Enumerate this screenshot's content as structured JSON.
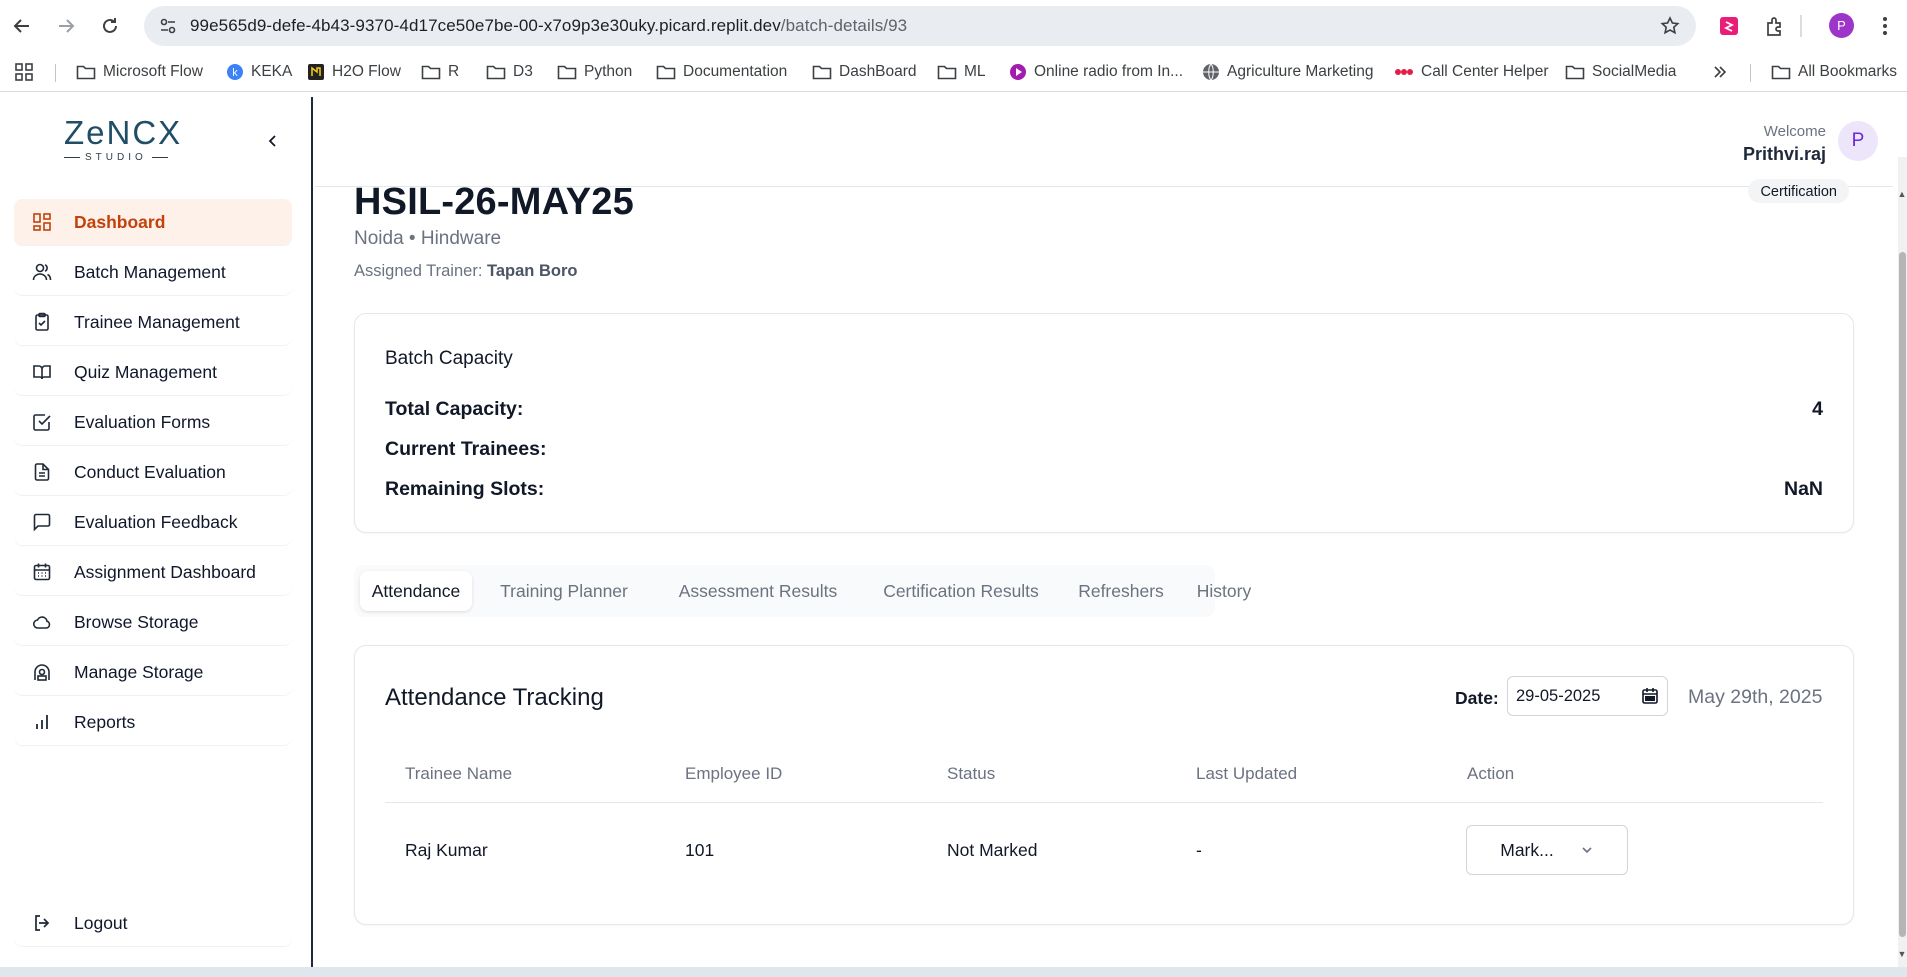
{
  "browser": {
    "url_host": "99e565d9-defe-4b43-9370-4d17ce50e7be-00-x7o9p3e30uky.picard.replit.dev",
    "url_path": "/batch-details/93",
    "profile_initial": "P",
    "bookmarks": [
      {
        "label": "Microsoft Flow",
        "icon": "folder-icon"
      },
      {
        "label": "KEKA",
        "icon": "keka-icon"
      },
      {
        "label": "H2O Flow",
        "icon": "h2o-icon"
      },
      {
        "label": "R",
        "icon": "folder-icon"
      },
      {
        "label": "D3",
        "icon": "folder-icon"
      },
      {
        "label": "Python",
        "icon": "folder-icon"
      },
      {
        "label": "Documentation",
        "icon": "folder-icon"
      },
      {
        "label": "DashBoard",
        "icon": "folder-icon"
      },
      {
        "label": "ML",
        "icon": "folder-icon"
      },
      {
        "label": "Online radio from In...",
        "icon": "radio-icon"
      },
      {
        "label": "Agriculture Marketing",
        "icon": "globe-icon"
      },
      {
        "label": "Call Center Helper",
        "icon": "dots-icon"
      },
      {
        "label": "SocialMedia",
        "icon": "folder-icon"
      }
    ],
    "all_bookmarks": "All Bookmarks"
  },
  "sidebar": {
    "logo_text": "ZeNCX",
    "logo_sub": "STUDIO",
    "items": [
      {
        "label": "Dashboard",
        "icon": "dashboard-icon",
        "active": true
      },
      {
        "label": "Batch Management",
        "icon": "users-icon"
      },
      {
        "label": "Trainee Management",
        "icon": "clipboard-check-icon"
      },
      {
        "label": "Quiz Management",
        "icon": "book-open-icon"
      },
      {
        "label": "Evaluation Forms",
        "icon": "check-square-icon"
      },
      {
        "label": "Conduct Evaluation",
        "icon": "file-text-icon"
      },
      {
        "label": "Evaluation Feedback",
        "icon": "message-square-icon"
      },
      {
        "label": "Assignment Dashboard",
        "icon": "calendar-icon"
      },
      {
        "label": "Browse Storage",
        "icon": "cloud-icon"
      },
      {
        "label": "Manage Storage",
        "icon": "storage-icon"
      },
      {
        "label": "Reports",
        "icon": "bar-chart-icon"
      }
    ],
    "logout": "Logout"
  },
  "header": {
    "welcome": "Welcome",
    "user_name": "Prithvi.raj",
    "avatar_initial": "P"
  },
  "batch": {
    "title": "HSIL-26-MAY25",
    "subtitle": "Noida • Hindware",
    "trainer_label": "Assigned Trainer:",
    "trainer_name": "Tapan Boro",
    "badge": "Certification"
  },
  "capacity": {
    "title": "Batch Capacity",
    "rows": [
      {
        "label": "Total Capacity:",
        "value": "4"
      },
      {
        "label": "Current Trainees:",
        "value": ""
      },
      {
        "label": "Remaining Slots:",
        "value": "NaN"
      }
    ]
  },
  "tabs": [
    "Attendance",
    "Training Planner",
    "Assessment Results",
    "Certification Results",
    "Refreshers",
    "History"
  ],
  "attendance": {
    "title": "Attendance Tracking",
    "date_label": "Date:",
    "date_value": "29-05-2025",
    "date_formatted": "May 29th, 2025",
    "columns": [
      "Trainee Name",
      "Employee ID",
      "Status",
      "Last Updated",
      "Action"
    ],
    "rows": [
      {
        "name": "Raj Kumar",
        "employee_id": "101",
        "status": "Not Marked",
        "last_updated": "-",
        "action": "Mark..."
      }
    ]
  },
  "colors": {
    "accent": "#c2410c",
    "active_bg": "#fdf1ea",
    "logo": "#1f4e66"
  }
}
